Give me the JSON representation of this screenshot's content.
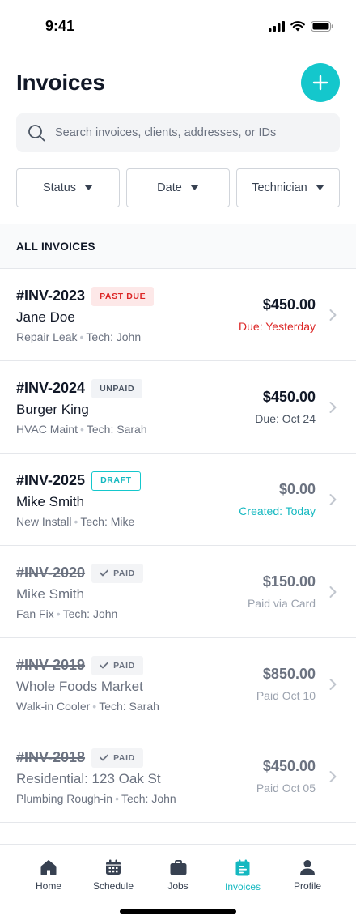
{
  "status_bar": {
    "time": "9:41"
  },
  "header": {
    "title": "Invoices",
    "add_icon": "plus-icon"
  },
  "search": {
    "placeholder": "Search invoices, clients, addresses, or IDs",
    "value": ""
  },
  "filters": [
    {
      "label": "Status"
    },
    {
      "label": "Date"
    },
    {
      "label": "Technician"
    }
  ],
  "section": {
    "title": "ALL INVOICES"
  },
  "invoices": [
    {
      "id": "#INV-2023",
      "badge": "PAST DUE",
      "client": "Jane Doe",
      "job": "Repair Leak",
      "tech": "Tech: John",
      "amount": "$450.00",
      "status": "Due: Yesterday"
    },
    {
      "id": "#INV-2024",
      "badge": "UNPAID",
      "client": "Burger King",
      "job": "HVAC Maint",
      "tech": "Tech: Sarah",
      "amount": "$450.00",
      "status": "Due: Oct 24"
    },
    {
      "id": "#INV-2025",
      "badge": "DRAFT",
      "client": "Mike Smith",
      "job": "New Install",
      "tech": "Tech: Mike",
      "amount": "$0.00",
      "status": "Created: Today"
    },
    {
      "id": "#INV-2020",
      "badge": "PAID",
      "client": "Mike Smith",
      "job": "Fan Fix",
      "tech": "Tech: John",
      "amount": "$150.00",
      "status": "Paid via Card"
    },
    {
      "id": "#INV-2019",
      "badge": "PAID",
      "client": "Whole Foods Market",
      "job": "Walk-in Cooler",
      "tech": "Tech: Sarah",
      "amount": "$850.00",
      "status": "Paid Oct 10"
    },
    {
      "id": "#INV-2018",
      "badge": "PAID",
      "client": "Residential: 123 Oak St",
      "job": "Plumbing Rough-in",
      "tech": "Tech: John",
      "amount": "$450.00",
      "status": "Paid Oct 05"
    }
  ],
  "bottom_nav": [
    {
      "label": "Home",
      "icon": "home-icon"
    },
    {
      "label": "Schedule",
      "icon": "calendar-icon"
    },
    {
      "label": "Jobs",
      "icon": "briefcase-icon"
    },
    {
      "label": "Invoices",
      "icon": "invoice-icon",
      "active": true
    },
    {
      "label": "Profile",
      "icon": "person-icon"
    }
  ],
  "colors": {
    "accent": "#14c7cc",
    "danger": "#dc2626",
    "text": "#111827",
    "muted": "#6b7280"
  }
}
